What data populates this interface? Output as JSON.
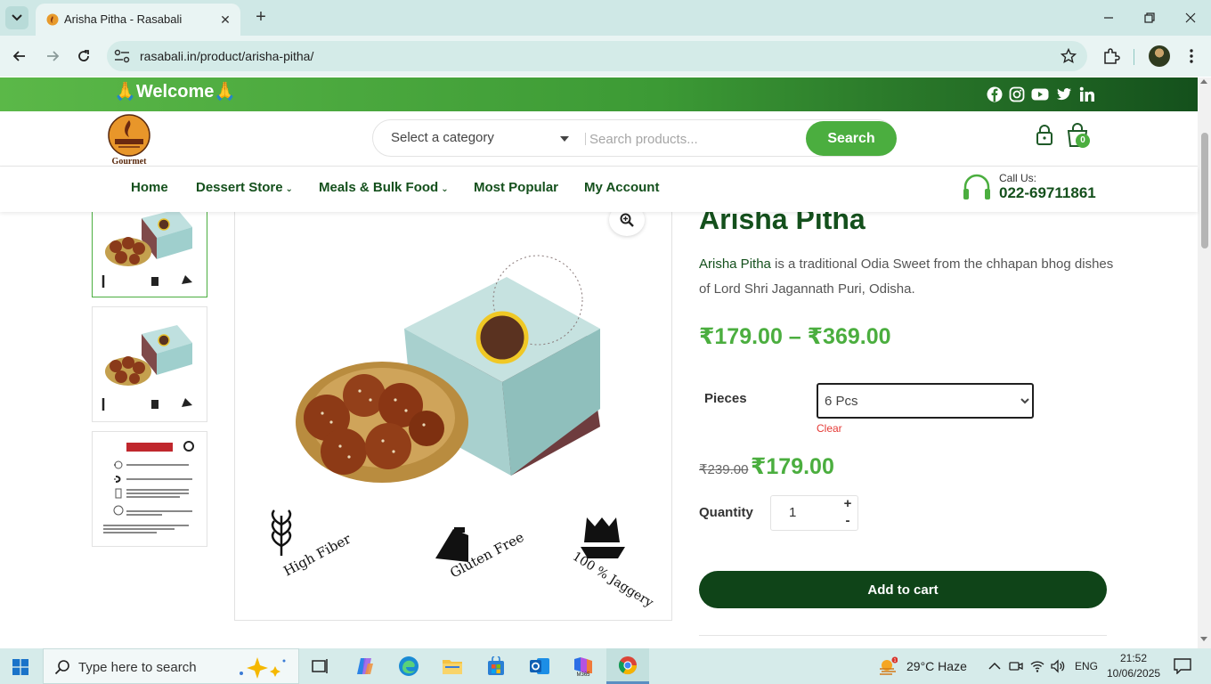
{
  "browser": {
    "tab_title": "Arisha Pitha - Rasabali",
    "url": "rasabali.in/product/arisha-pitha/"
  },
  "site": {
    "welcome": "🙏Welcome🙏",
    "social_icons": [
      "facebook-icon",
      "instagram-icon",
      "youtube-icon",
      "twitter-icon",
      "linkedin-icon"
    ],
    "logo_text": "Gourmet",
    "category_placeholder": "Select a category",
    "search_placeholder": "Search products...",
    "search_button": "Search",
    "cart_count": "0",
    "nav": {
      "home": "Home",
      "dessert_store": "Dessert Store",
      "meals_bulk": "Meals & Bulk Food",
      "most_popular": "Most Popular",
      "my_account": "My Account"
    },
    "call_label": "Call Us:",
    "call_number": "022-69711861",
    "accent_green": "#4bae3f",
    "dark_green": "#14501c"
  },
  "product": {
    "title": "Arisha Pitha",
    "desc_highlight": "Arisha Pitha",
    "desc_rest": " is a traditional Odia Sweet from the chhapan bhog dishes of Lord Shri Jagannath Puri, Odisha.",
    "price_range": "₹179.00 – ₹369.00",
    "pieces_label": "Pieces",
    "pieces_selected": "6 Pcs",
    "clear": "Clear",
    "old_price": "₹239.00",
    "new_price": "₹179.00",
    "quantity_label": "Quantity",
    "quantity": "1",
    "plus": "+",
    "minus": "-",
    "add_to_cart": "Add to cart",
    "image_badges": [
      "High Fiber",
      "Gluten Free",
      "100 % Jaggery"
    ]
  },
  "taskbar": {
    "search_text": "Type here to search",
    "weather": "29°C  Haze",
    "weather_badge": "1",
    "lang": "ENG",
    "time": "21:52",
    "date": "10/06/2025"
  }
}
